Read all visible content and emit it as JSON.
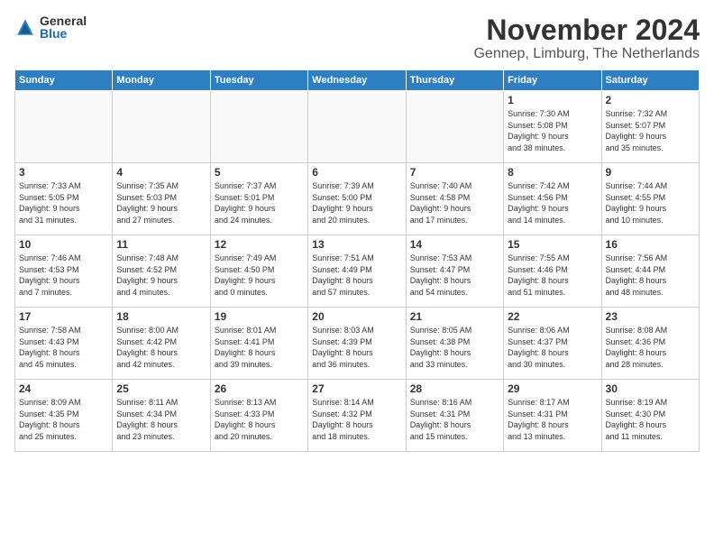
{
  "header": {
    "logo_general": "General",
    "logo_blue": "Blue",
    "month_title": "November 2024",
    "location": "Gennep, Limburg, The Netherlands"
  },
  "days_of_week": [
    "Sunday",
    "Monday",
    "Tuesday",
    "Wednesday",
    "Thursday",
    "Friday",
    "Saturday"
  ],
  "weeks": [
    [
      {
        "day": "",
        "info": ""
      },
      {
        "day": "",
        "info": ""
      },
      {
        "day": "",
        "info": ""
      },
      {
        "day": "",
        "info": ""
      },
      {
        "day": "",
        "info": ""
      },
      {
        "day": "1",
        "info": "Sunrise: 7:30 AM\nSunset: 5:08 PM\nDaylight: 9 hours\nand 38 minutes."
      },
      {
        "day": "2",
        "info": "Sunrise: 7:32 AM\nSunset: 5:07 PM\nDaylight: 9 hours\nand 35 minutes."
      }
    ],
    [
      {
        "day": "3",
        "info": "Sunrise: 7:33 AM\nSunset: 5:05 PM\nDaylight: 9 hours\nand 31 minutes."
      },
      {
        "day": "4",
        "info": "Sunrise: 7:35 AM\nSunset: 5:03 PM\nDaylight: 9 hours\nand 27 minutes."
      },
      {
        "day": "5",
        "info": "Sunrise: 7:37 AM\nSunset: 5:01 PM\nDaylight: 9 hours\nand 24 minutes."
      },
      {
        "day": "6",
        "info": "Sunrise: 7:39 AM\nSunset: 5:00 PM\nDaylight: 9 hours\nand 20 minutes."
      },
      {
        "day": "7",
        "info": "Sunrise: 7:40 AM\nSunset: 4:58 PM\nDaylight: 9 hours\nand 17 minutes."
      },
      {
        "day": "8",
        "info": "Sunrise: 7:42 AM\nSunset: 4:56 PM\nDaylight: 9 hours\nand 14 minutes."
      },
      {
        "day": "9",
        "info": "Sunrise: 7:44 AM\nSunset: 4:55 PM\nDaylight: 9 hours\nand 10 minutes."
      }
    ],
    [
      {
        "day": "10",
        "info": "Sunrise: 7:46 AM\nSunset: 4:53 PM\nDaylight: 9 hours\nand 7 minutes."
      },
      {
        "day": "11",
        "info": "Sunrise: 7:48 AM\nSunset: 4:52 PM\nDaylight: 9 hours\nand 4 minutes."
      },
      {
        "day": "12",
        "info": "Sunrise: 7:49 AM\nSunset: 4:50 PM\nDaylight: 9 hours\nand 0 minutes."
      },
      {
        "day": "13",
        "info": "Sunrise: 7:51 AM\nSunset: 4:49 PM\nDaylight: 8 hours\nand 57 minutes."
      },
      {
        "day": "14",
        "info": "Sunrise: 7:53 AM\nSunset: 4:47 PM\nDaylight: 8 hours\nand 54 minutes."
      },
      {
        "day": "15",
        "info": "Sunrise: 7:55 AM\nSunset: 4:46 PM\nDaylight: 8 hours\nand 51 minutes."
      },
      {
        "day": "16",
        "info": "Sunrise: 7:56 AM\nSunset: 4:44 PM\nDaylight: 8 hours\nand 48 minutes."
      }
    ],
    [
      {
        "day": "17",
        "info": "Sunrise: 7:58 AM\nSunset: 4:43 PM\nDaylight: 8 hours\nand 45 minutes."
      },
      {
        "day": "18",
        "info": "Sunrise: 8:00 AM\nSunset: 4:42 PM\nDaylight: 8 hours\nand 42 minutes."
      },
      {
        "day": "19",
        "info": "Sunrise: 8:01 AM\nSunset: 4:41 PM\nDaylight: 8 hours\nand 39 minutes."
      },
      {
        "day": "20",
        "info": "Sunrise: 8:03 AM\nSunset: 4:39 PM\nDaylight: 8 hours\nand 36 minutes."
      },
      {
        "day": "21",
        "info": "Sunrise: 8:05 AM\nSunset: 4:38 PM\nDaylight: 8 hours\nand 33 minutes."
      },
      {
        "day": "22",
        "info": "Sunrise: 8:06 AM\nSunset: 4:37 PM\nDaylight: 8 hours\nand 30 minutes."
      },
      {
        "day": "23",
        "info": "Sunrise: 8:08 AM\nSunset: 4:36 PM\nDaylight: 8 hours\nand 28 minutes."
      }
    ],
    [
      {
        "day": "24",
        "info": "Sunrise: 8:09 AM\nSunset: 4:35 PM\nDaylight: 8 hours\nand 25 minutes."
      },
      {
        "day": "25",
        "info": "Sunrise: 8:11 AM\nSunset: 4:34 PM\nDaylight: 8 hours\nand 23 minutes."
      },
      {
        "day": "26",
        "info": "Sunrise: 8:13 AM\nSunset: 4:33 PM\nDaylight: 8 hours\nand 20 minutes."
      },
      {
        "day": "27",
        "info": "Sunrise: 8:14 AM\nSunset: 4:32 PM\nDaylight: 8 hours\nand 18 minutes."
      },
      {
        "day": "28",
        "info": "Sunrise: 8:16 AM\nSunset: 4:31 PM\nDaylight: 8 hours\nand 15 minutes."
      },
      {
        "day": "29",
        "info": "Sunrise: 8:17 AM\nSunset: 4:31 PM\nDaylight: 8 hours\nand 13 minutes."
      },
      {
        "day": "30",
        "info": "Sunrise: 8:19 AM\nSunset: 4:30 PM\nDaylight: 8 hours\nand 11 minutes."
      }
    ]
  ]
}
